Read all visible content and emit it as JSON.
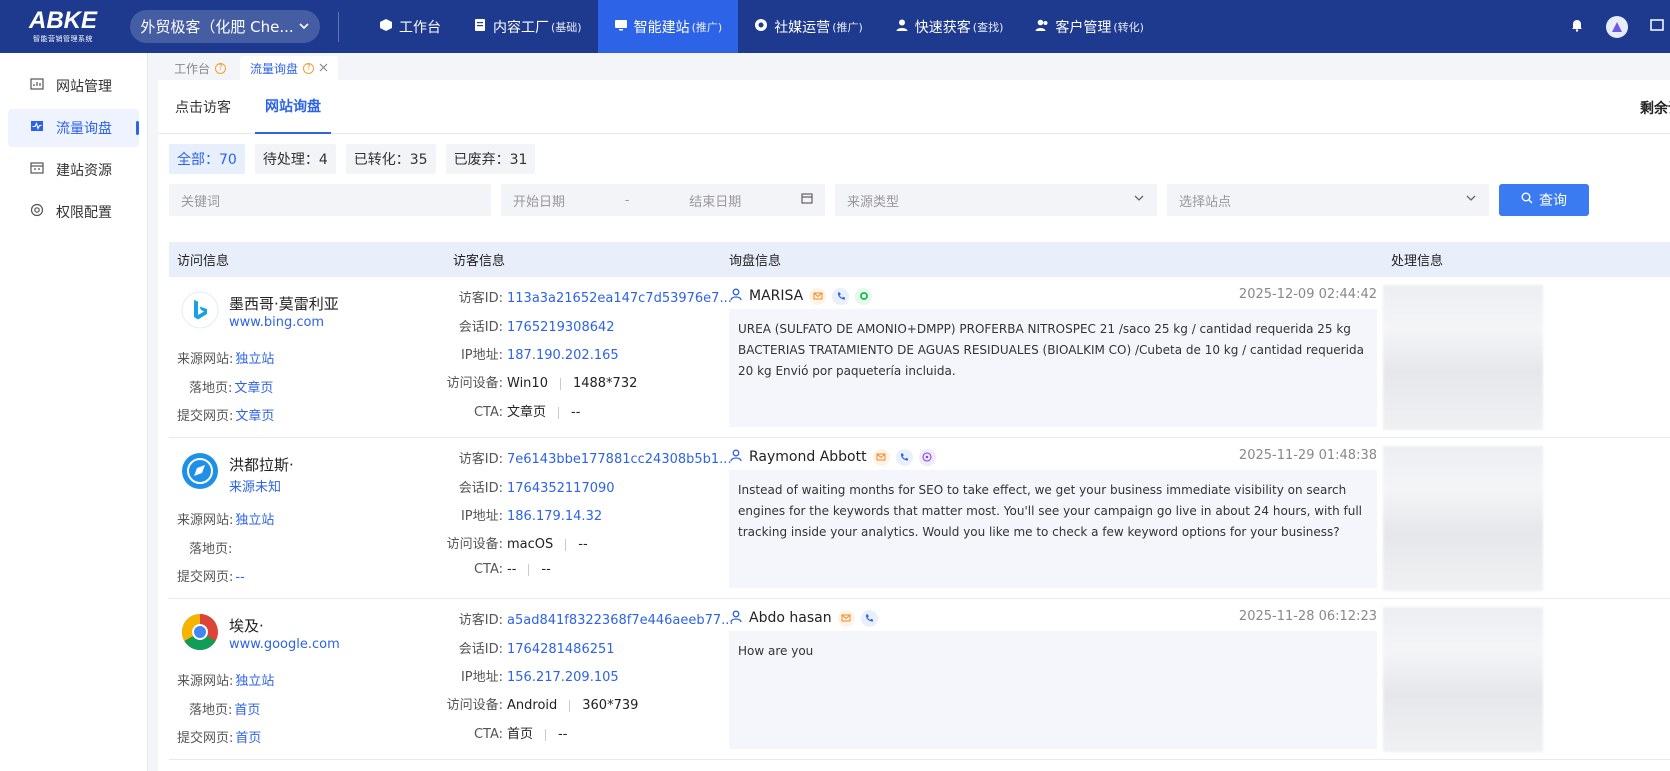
{
  "topbar": {
    "logo_text": "ABKE",
    "logo_sub": "智能营销管理系统",
    "company": "外贸极客（化肥 Che...",
    "nav": [
      {
        "label": "工作台",
        "sub": ""
      },
      {
        "label": "内容工厂",
        "sub": "(基础)"
      },
      {
        "label": "智能建站",
        "sub": "(推广)"
      },
      {
        "label": "社媒运营",
        "sub": "(推广)"
      },
      {
        "label": "快速获客",
        "sub": "(查找)"
      },
      {
        "label": "客户管理",
        "sub": "(转化)"
      }
    ]
  },
  "sidebar": {
    "items": [
      {
        "label": "网站管理"
      },
      {
        "label": "流量询盘"
      },
      {
        "label": "建站资源"
      },
      {
        "label": "权限配置"
      }
    ]
  },
  "page_tabs": [
    {
      "label": "工作台"
    },
    {
      "label": "流量询盘"
    }
  ],
  "subtabs": [
    {
      "label": "点击访客"
    },
    {
      "label": "网站询盘"
    }
  ],
  "remain_label": "剩余询",
  "filters": [
    {
      "label": "全部：70"
    },
    {
      "label": "待处理：4"
    },
    {
      "label": "已转化：35"
    },
    {
      "label": "已废弃：31"
    }
  ],
  "search": {
    "keyword_placeholder": "关键词",
    "start_date_placeholder": "开始日期",
    "date_sep": "-",
    "end_date_placeholder": "结束日期",
    "source_type_placeholder": "来源类型",
    "site_placeholder": "选择站点",
    "button_label": "查询"
  },
  "table": {
    "headers": [
      "访问信息",
      "访客信息",
      "询盘信息",
      "处理信息"
    ],
    "rows": [
      {
        "icon": "bing-icon",
        "country": "墨西哥·莫雷利亚",
        "site": "www.bing.com",
        "source_label": "来源网站:",
        "source": "独立站",
        "landing_label": "落地页:",
        "landing": "文章页",
        "submit_label": "提交网页:",
        "submit": "文章页",
        "visitor_id_label": "访客ID:",
        "visitor_id": "113a3a21652ea147c7d53976e7...",
        "session_id_label": "会话ID:",
        "session_id": "1765219308642",
        "ip_label": "IP地址:",
        "ip": "187.190.202.165",
        "device_label": "访问设备:",
        "device": "Win10",
        "resolution": "1488*732",
        "cta_label": "CTA:",
        "cta": "文章页",
        "cta2": "--",
        "name": "MARISA",
        "time": "2025-12-09 02:44:42",
        "message": "UREA (SULFATO DE AMONIO+DMPP) PROFERBA NITROSPEC 21 /saco 25 kg / cantidad requerida 25 kg BACTERIAS TRATAMIENTO DE AGUAS RESIDUALES (BIOALKIM CO) /Cubeta de 10 kg / cantidad requerida 20 kg Envió por paquetería incluida."
      },
      {
        "icon": "compass-icon",
        "country": "洪都拉斯·",
        "site": "来源未知",
        "source_label": "来源网站:",
        "source": "独立站",
        "landing_label": "落地页:",
        "landing": "",
        "submit_label": "提交网页:",
        "submit": "--",
        "visitor_id_label": "访客ID:",
        "visitor_id": "7e6143bbe177881cc24308b5b1...",
        "session_id_label": "会话ID:",
        "session_id": "1764352117090",
        "ip_label": "IP地址:",
        "ip": "186.179.14.32",
        "device_label": "访问设备:",
        "device": "macOS",
        "resolution": "--",
        "cta_label": "CTA:",
        "cta": "--",
        "cta2": "--",
        "name": "Raymond Abbott",
        "time": "2025-11-29 01:48:38",
        "message": "Instead of waiting months for SEO to take effect, we get your business immediate visibility on search engines for the keywords that matter most. You'll see your campaign go live in about 24 hours, with full tracking inside your analytics. Would you like me to check a few keyword options for your business?"
      },
      {
        "icon": "chrome-icon",
        "country": "埃及·",
        "site": "www.google.com",
        "source_label": "来源网站:",
        "source": "独立站",
        "landing_label": "落地页:",
        "landing": "首页",
        "submit_label": "提交网页:",
        "submit": "首页",
        "visitor_id_label": "访客ID:",
        "visitor_id": "a5ad841f8322368f7e446aeeb77...",
        "session_id_label": "会话ID:",
        "session_id": "1764281486251",
        "ip_label": "IP地址:",
        "ip": "156.217.209.105",
        "device_label": "访问设备:",
        "device": "Android",
        "resolution": "360*739",
        "cta_label": "CTA:",
        "cta": "首页",
        "cta2": "--",
        "name": "Abdo hasan",
        "time": "2025-11-28 06:12:23",
        "message": "How are you"
      }
    ]
  }
}
